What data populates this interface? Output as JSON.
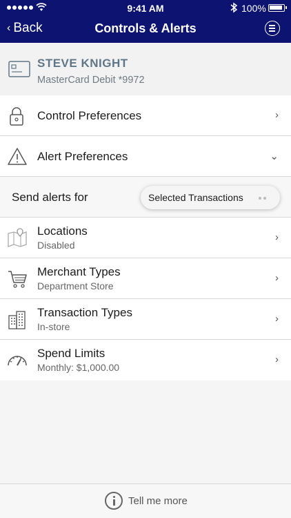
{
  "status_bar": {
    "time": "9:41 AM",
    "battery": "100%"
  },
  "nav": {
    "back_label": "Back",
    "title": "Controls & Alerts"
  },
  "card": {
    "name": "STEVE KNIGHT",
    "description": "MasterCard Debit *9972"
  },
  "sections": {
    "control_preferences": "Control Preferences",
    "alert_preferences": "Alert Preferences"
  },
  "send_alerts": {
    "label": "Send alerts for",
    "selected": "Selected Transactions"
  },
  "alert_items": [
    {
      "label": "Locations",
      "value": "Disabled",
      "icon": "map-icon"
    },
    {
      "label": "Merchant Types",
      "value": "Department Store",
      "icon": "cart-icon"
    },
    {
      "label": "Transaction Types",
      "value": "In-store",
      "icon": "building-icon"
    },
    {
      "label": "Spend Limits",
      "value": "Monthly: $1,000.00",
      "icon": "gauge-icon"
    }
  ],
  "footer": {
    "label": "Tell me more"
  },
  "colors": {
    "header": "#0d1370",
    "card_name": "#5f7688"
  }
}
